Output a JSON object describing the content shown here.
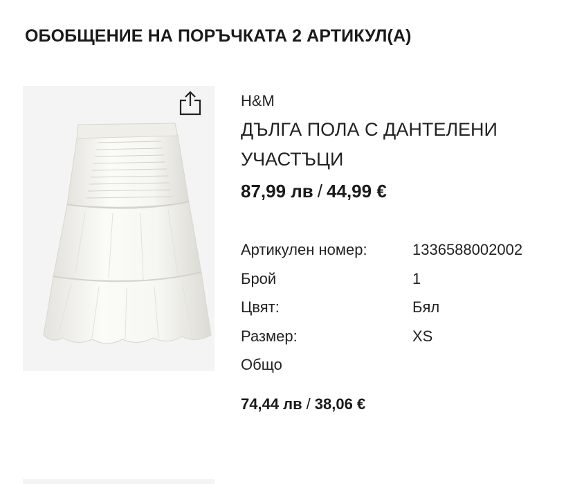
{
  "order_summary": {
    "title": "ОБОБЩЕНИЕ НА ПОРЪЧКАТА 2 АРТИКУЛ(А)"
  },
  "product": {
    "brand": "H&M",
    "name": "ДЪЛГА ПОЛА С ДАНТЕЛЕНИ УЧАСТЪЦИ",
    "price_bgn": "87,99 лв",
    "price_separator": "/",
    "price_eur": "44,99 €",
    "image_icon": "skirt-image",
    "share_icon": "share-icon",
    "specs": [
      {
        "label": "Артикулен номер:",
        "value": "1336588002002"
      },
      {
        "label": "Брой",
        "value": "1"
      },
      {
        "label": "Цвят:",
        "value": "Бял"
      },
      {
        "label": "Размер:",
        "value": "XS"
      },
      {
        "label": "Общо",
        "value": ""
      }
    ],
    "total_bgn": "74,44 лв",
    "total_separator": "/",
    "total_eur": "38,06 €"
  },
  "colors": {
    "image_background": "#f4f4f4",
    "text": "#222222"
  }
}
